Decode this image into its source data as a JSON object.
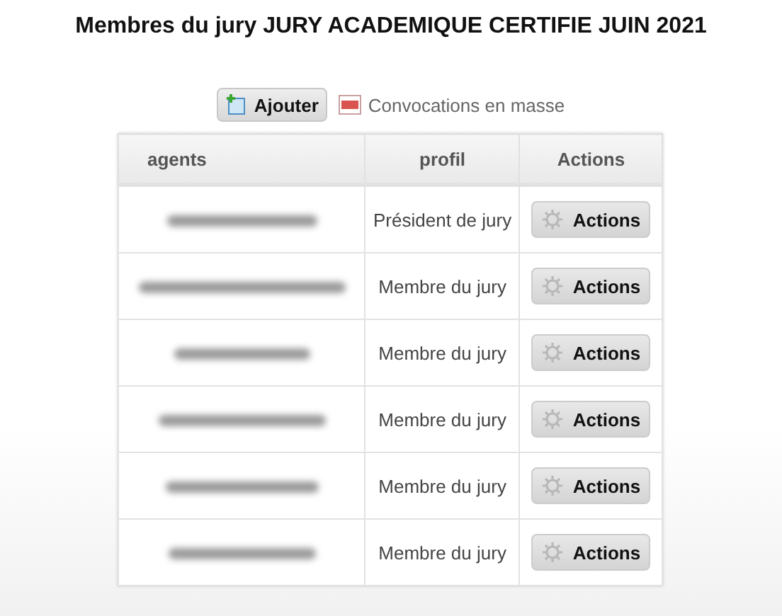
{
  "title": "Membres du jury JURY ACADEMIQUE CERTIFIE JUIN 2021",
  "toolbar": {
    "add_button": "Ajouter",
    "bulk_link": "Convocations en masse"
  },
  "table": {
    "columns": [
      "agents",
      "profil",
      "Actions"
    ],
    "rows": [
      {
        "agent_redacted": true,
        "profil": "Président de jury",
        "action": "Actions"
      },
      {
        "agent_redacted": true,
        "profil": "Membre du jury",
        "action": "Actions"
      },
      {
        "agent_redacted": true,
        "profil": "Membre du jury",
        "action": "Actions"
      },
      {
        "agent_redacted": true,
        "profil": "Membre du jury",
        "action": "Actions"
      },
      {
        "agent_redacted": true,
        "profil": "Membre du jury",
        "action": "Actions"
      },
      {
        "agent_redacted": true,
        "profil": "Membre du jury",
        "action": "Actions"
      }
    ]
  }
}
